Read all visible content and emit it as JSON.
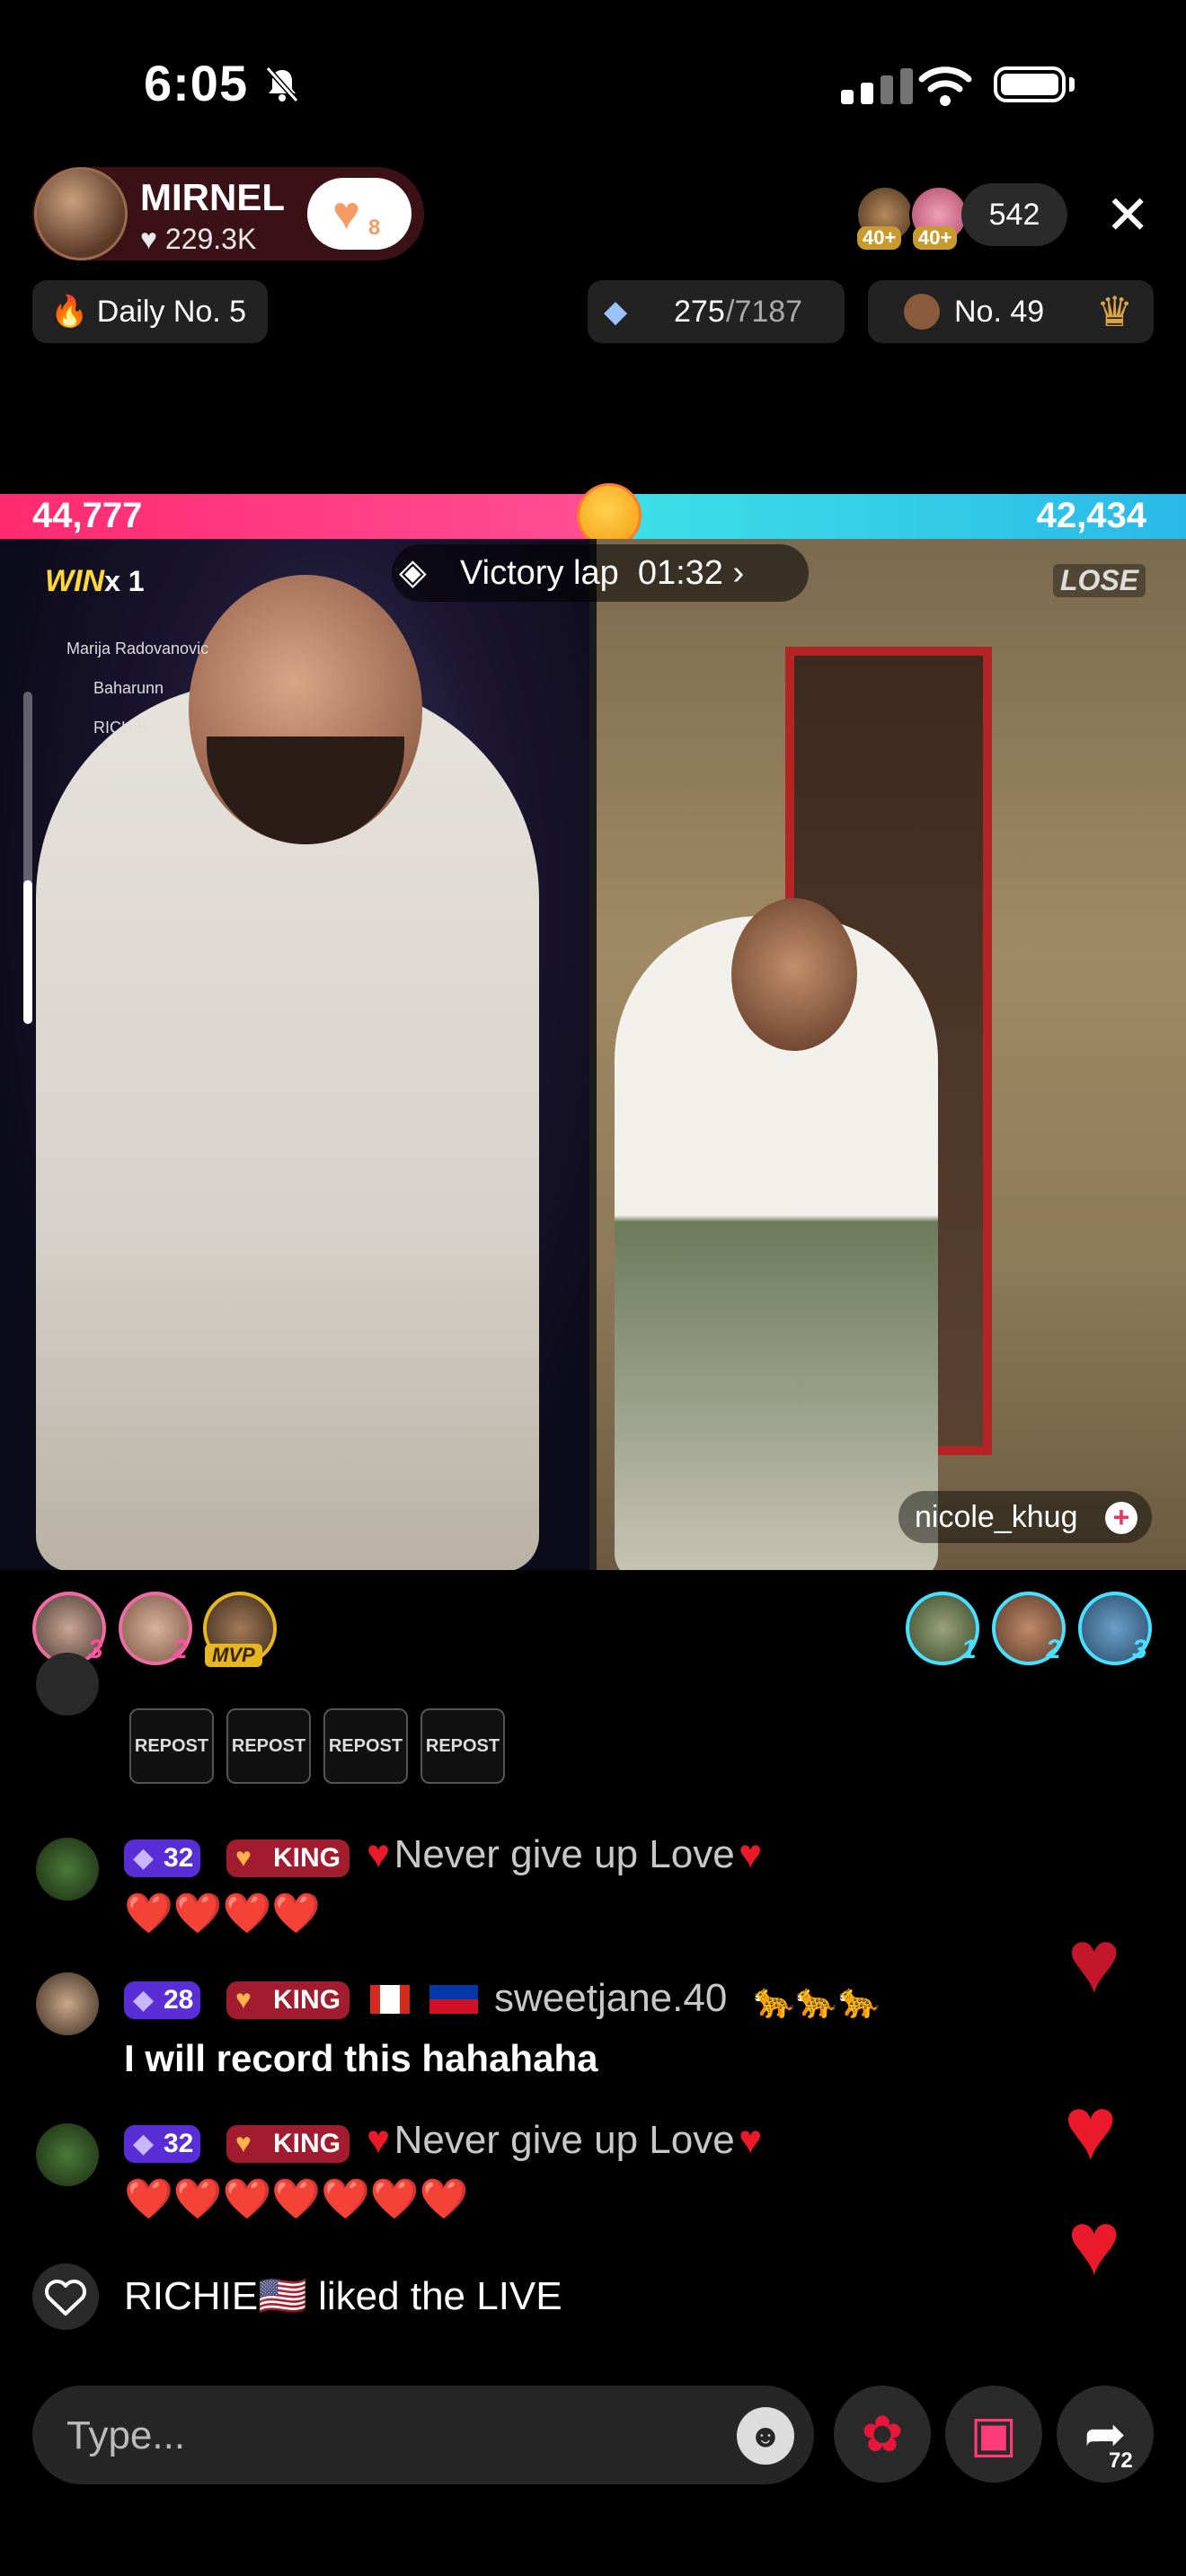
{
  "status_bar": {
    "time": "6:05"
  },
  "host": {
    "name": "MIRNEL",
    "likes": "229.3K",
    "follow_count": "8"
  },
  "viewers": {
    "badge_1": "40+",
    "badge_2": "40+",
    "count": "542"
  },
  "chips": {
    "daily": "Daily No. 5",
    "score_current": "275",
    "score_total": "/7187",
    "rank": "No. 49"
  },
  "battle": {
    "left_score": "44,777",
    "right_score": "42,434",
    "win_label": "WIN",
    "win_count": "x 1",
    "lose_label": "LOSE",
    "victory_text": "Victory lap",
    "victory_timer": "01:32"
  },
  "mini_list": [
    "Marija Radovanovic",
    "Baharunn",
    "RICHIE"
  ],
  "right_stream_user": "nicole_khug",
  "gifters": {
    "left": [
      "3",
      "2",
      "MVP"
    ],
    "right": [
      "1",
      "2",
      "3"
    ]
  },
  "reposts": [
    "REPOST",
    "REPOST",
    "REPOST",
    "REPOST"
  ],
  "chat": [
    {
      "level": "32",
      "badge": "KING",
      "text": "Never give up Love",
      "line2": "❤️❤️❤️❤️"
    },
    {
      "level": "28",
      "badge": "KING",
      "username": "sweetjane.40",
      "text": "I will record this hahahaha"
    },
    {
      "level": "32",
      "badge": "KING",
      "text": "Never give up Love",
      "line2": "❤️❤️❤️❤️❤️❤️❤️"
    }
  ],
  "liked": "RICHIE🇺🇸 liked the LIVE",
  "input": {
    "placeholder": "Type..."
  },
  "share_count": "72",
  "colors": {
    "battle_left": "#ff2a6f",
    "battle_right": "#2bb9e8",
    "level_badge": "#5a2ed6",
    "king_badge": "#a01c2e",
    "heart": "#ea1a2a"
  }
}
